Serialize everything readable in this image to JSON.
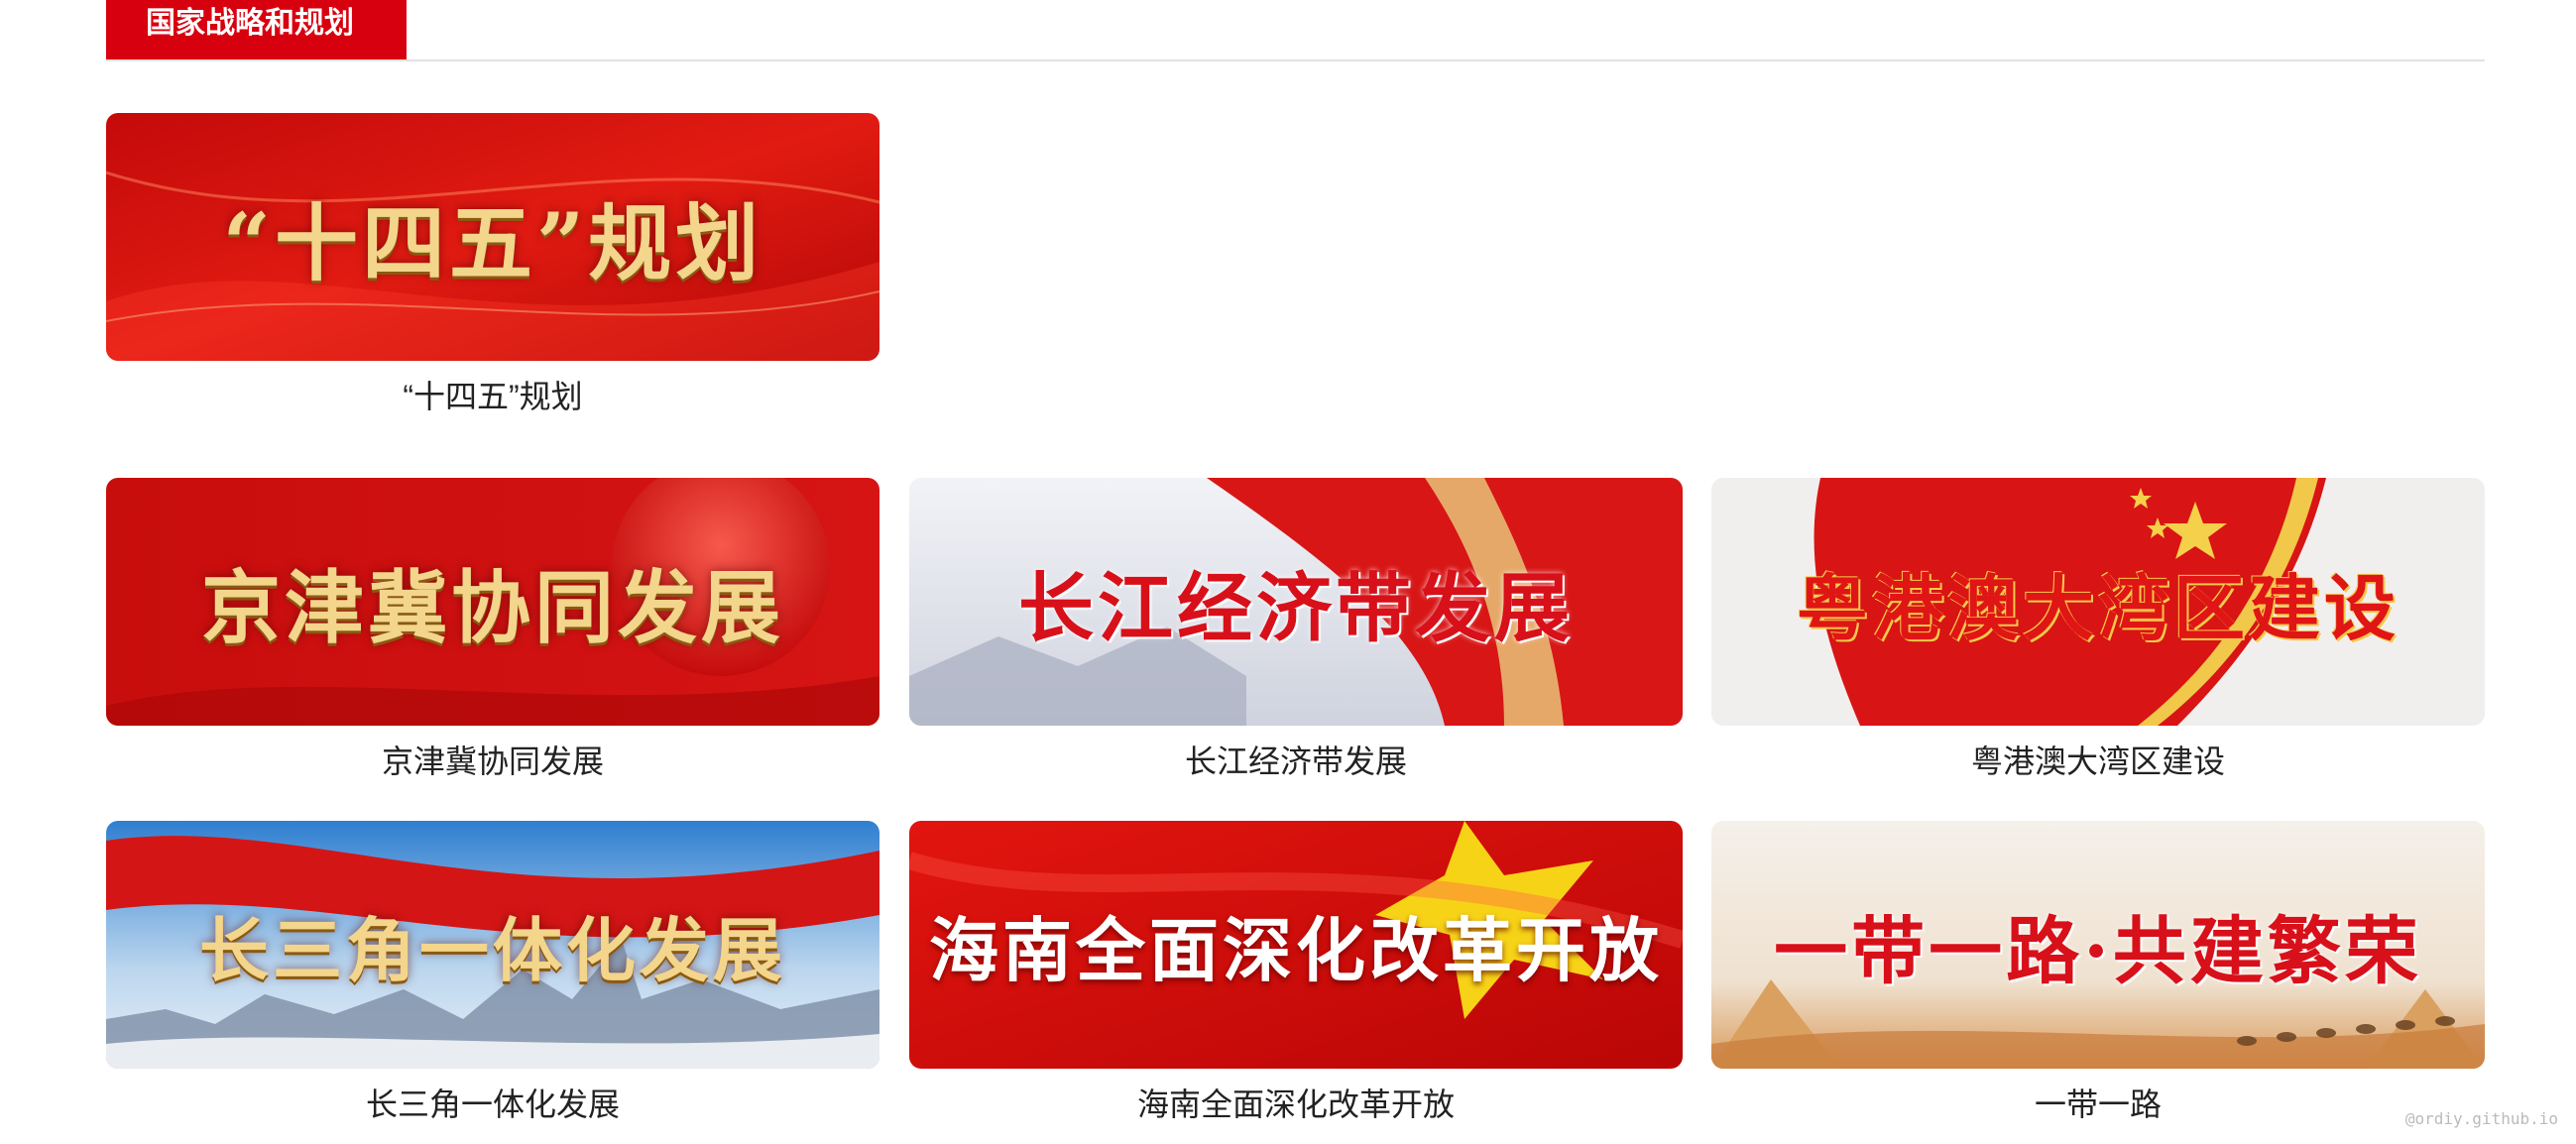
{
  "section": {
    "title": "国家战略和规划"
  },
  "cards": [
    {
      "banner_text": "“十四五”规划",
      "caption": "“十四五”规划"
    },
    {
      "banner_text": "京津冀协同发展",
      "caption": "京津冀协同发展"
    },
    {
      "banner_text": "长江经济带发展",
      "caption": "长江经济带发展"
    },
    {
      "banner_text": "粤港澳大湾区建设",
      "caption": "粤港澳大湾区建设"
    },
    {
      "banner_text": "长三角一体化发展",
      "caption": "长三角一体化发展"
    },
    {
      "banner_text": "海南全面深化改革开放",
      "caption": "海南全面深化改革开放"
    },
    {
      "banner_text": "一带一路·共建繁荣",
      "caption": "一带一路"
    }
  ],
  "watermark": "@ordiy.github.io",
  "colors": {
    "accent": "#d7000f",
    "divider": "#e2e2e2",
    "text": "#222222"
  }
}
